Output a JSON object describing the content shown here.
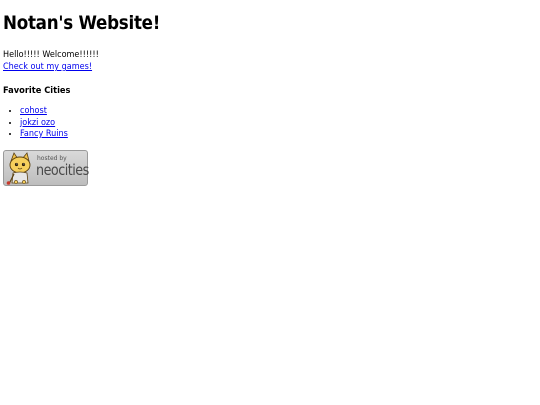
{
  "page": {
    "title": "Notan's Website!",
    "greeting": "Hello!!!!! Welcome!!!!!!",
    "games_link": "Check out my games!"
  },
  "favorites": {
    "heading": "Favorite Cities",
    "items": [
      {
        "label": "cohost"
      },
      {
        "label": "jokzi ozo"
      },
      {
        "label": "Fancy Ruins"
      }
    ]
  },
  "badge": {
    "hosted_by": "hosted by",
    "brand": "neocities",
    "icon": "neocities-cat-mascot-icon"
  },
  "colors": {
    "link": "#0000ee",
    "background": "#ffffff",
    "text": "#000000"
  }
}
